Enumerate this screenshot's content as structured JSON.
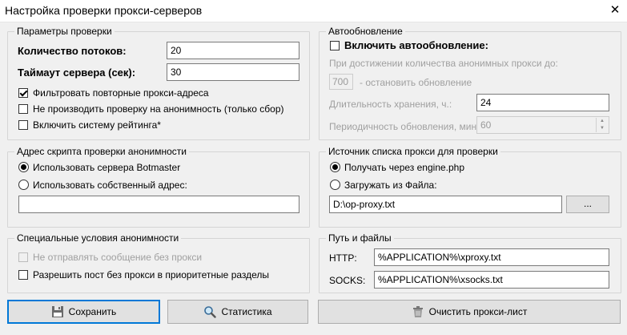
{
  "window": {
    "title": "Настройка проверки прокси-серверов",
    "close_glyph": "✕"
  },
  "check_params": {
    "title": "Параметры проверки",
    "threads_label": "Количество потоков:",
    "threads_value": "20",
    "timeout_label": "Таймаут сервера (сек):",
    "timeout_value": "30",
    "filter_duplicates": {
      "label": "Фильтровать повторные прокси-адреса",
      "checked": true
    },
    "no_anonymity_check": {
      "label": "Не производить проверку на анонимность (только сбор)",
      "checked": false
    },
    "rating_system": {
      "label": "Включить систему рейтинга*",
      "checked": false
    }
  },
  "auto_update": {
    "title": "Автообновление",
    "enable": {
      "label": "Включить автообновление:",
      "checked": false
    },
    "threshold_text": "При достижении количества анонимных прокси до:",
    "threshold_value": "700",
    "stop_text": "- остановить обновление",
    "retention_label": "Длительность хранения, ч.:",
    "retention_value": "24",
    "period_label": "Периодичность обновления, мин.:",
    "period_value": "60"
  },
  "anon_script": {
    "title": "Адрес скрипта проверки анонимности",
    "option_botmaster": {
      "label": "Использовать сервера Botmaster",
      "selected": true
    },
    "option_custom": {
      "label": "Использовать собственный адрес:",
      "selected": false
    },
    "custom_value": ""
  },
  "proxy_source": {
    "title": "Источник списка прокси для проверки",
    "option_engine": {
      "label": "Получать через engine.php",
      "selected": true
    },
    "option_file": {
      "label": "Загружать из Файла:",
      "selected": false
    },
    "file_value": "D:\\op-proxy.txt",
    "browse_label": "..."
  },
  "special_conditions": {
    "title": "Специальные условия анонимности",
    "no_send": {
      "label": "Не отправлять сообщение без прокси",
      "checked": false,
      "disabled": true
    },
    "allow_post": {
      "label": "Разрешить пост без прокси в приоритетные разделы",
      "checked": false
    }
  },
  "paths": {
    "title": "Путь и файлы",
    "http_label": "HTTP:",
    "http_value": "%APPLICATION%\\xproxy.txt",
    "socks_label": "SOCKS:",
    "socks_value": "%APPLICATION%\\xsocks.txt"
  },
  "buttons": {
    "save": {
      "label": "Сохранить",
      "icon": "save-icon"
    },
    "stats": {
      "label": "Статистика",
      "icon": "magnifier-icon"
    },
    "clear": {
      "label": "Очистить прокси-лист",
      "icon": "trash-icon"
    }
  }
}
